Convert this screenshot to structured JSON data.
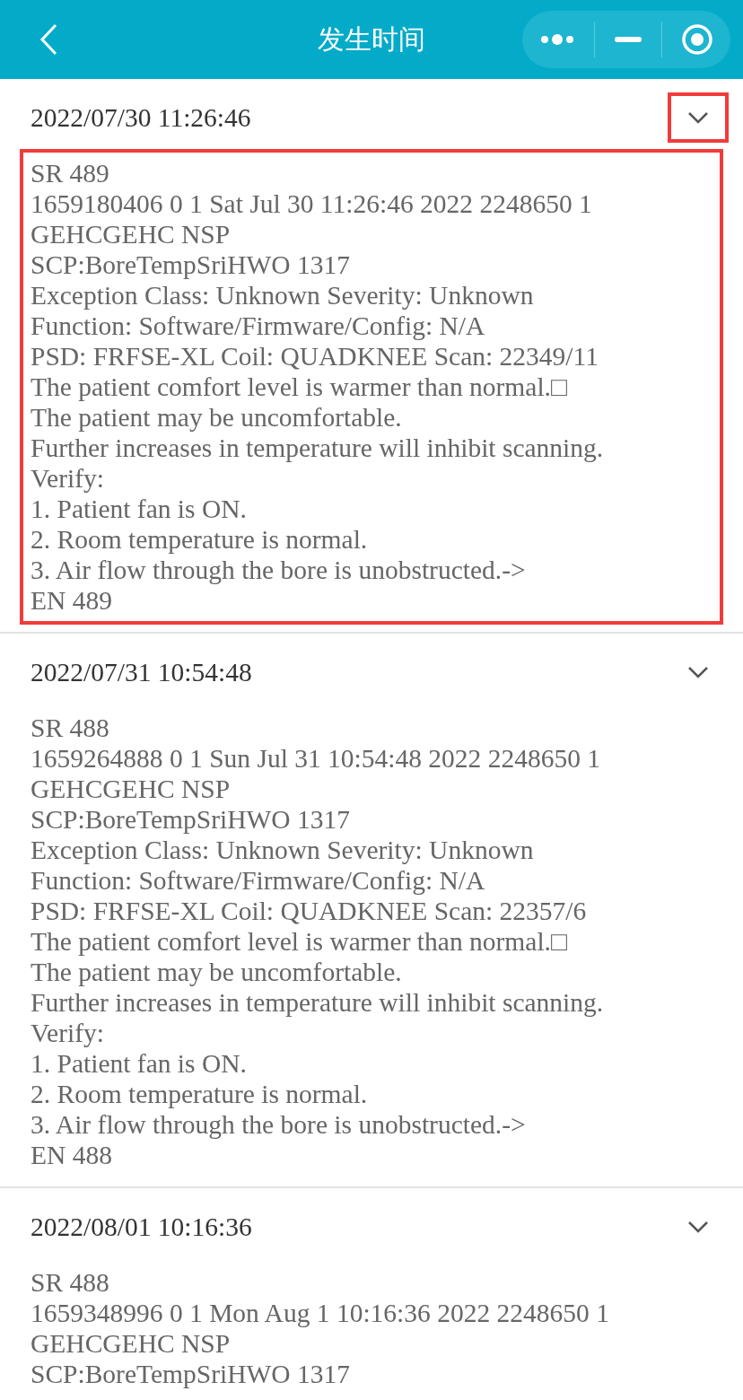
{
  "header": {
    "title": "发生时间"
  },
  "records": [
    {
      "time": "2022/07/30 11:26:46",
      "highlighted": true,
      "lines": [
        "SR 489",
        "1659180406 0 1 Sat Jul 30 11:26:46 2022 2248650 1",
        "GEHCGEHC NSP",
        "SCP:BoreTempSriHWO 1317",
        "Exception Class: Unknown Severity: Unknown",
        "Function: Software/Firmware/Config: N/A",
        "PSD: FRFSE-XL Coil: QUADKNEE Scan: 22349/11",
        "The patient comfort level is warmer than normal.□",
        "The patient may be uncomfortable.",
        "Further increases in temperature will inhibit scanning.",
        "Verify:",
        "1. Patient fan is ON.",
        "2. Room temperature is normal.",
        "3. Air flow through the bore is unobstructed.->",
        "EN 489"
      ]
    },
    {
      "time": "2022/07/31 10:54:48",
      "highlighted": false,
      "lines": [
        "SR 488",
        "1659264888 0 1 Sun Jul 31 10:54:48 2022 2248650 1",
        "GEHCGEHC NSP",
        "SCP:BoreTempSriHWO 1317",
        "Exception Class: Unknown Severity: Unknown",
        "Function: Software/Firmware/Config: N/A",
        "PSD: FRFSE-XL Coil: QUADKNEE Scan: 22357/6",
        "The patient comfort level is warmer than normal.□",
        "The patient may be uncomfortable.",
        "Further increases in temperature will inhibit scanning.",
        "Verify:",
        "1. Patient fan is ON.",
        "2. Room temperature is normal.",
        "3. Air flow through the bore is unobstructed.->",
        "EN 488"
      ]
    },
    {
      "time": "2022/08/01 10:16:36",
      "highlighted": false,
      "lines": [
        "SR 488",
        "1659348996 0 1 Mon Aug 1 10:16:36 2022 2248650 1",
        "GEHCGEHC NSP",
        "SCP:BoreTempSriHWO 1317"
      ]
    }
  ]
}
